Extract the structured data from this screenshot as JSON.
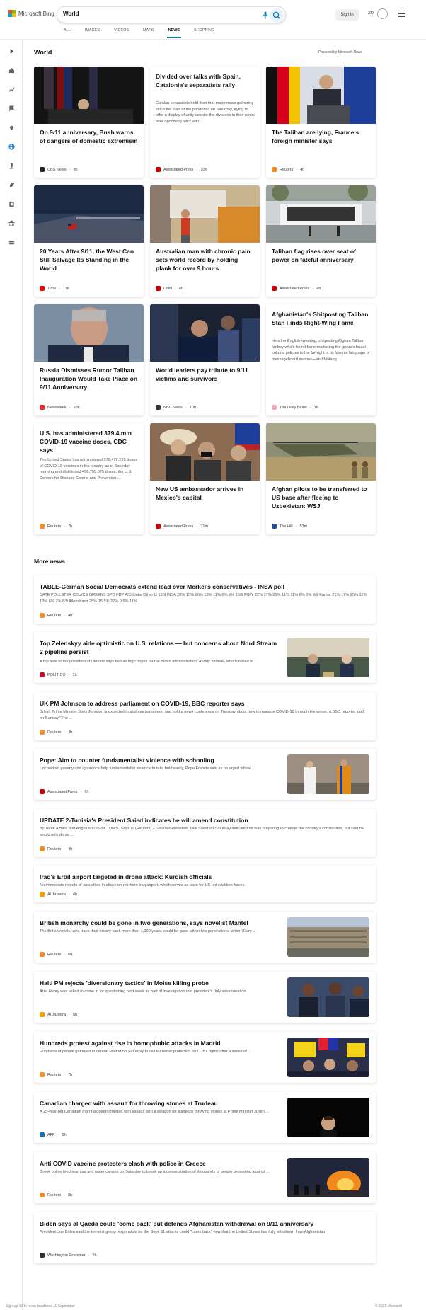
{
  "header": {
    "brand": "Microsoft Bing",
    "search_value": "World",
    "sign_in": "Sign in",
    "points": "20"
  },
  "tabs": [
    {
      "label": "ALL"
    },
    {
      "label": "IMAGES"
    },
    {
      "label": "VIDEOS"
    },
    {
      "label": "MAPS"
    },
    {
      "label": "NEWS",
      "active": true
    },
    {
      "label": "SHOPPING"
    }
  ],
  "section": {
    "title": "World",
    "powered": "Powered by Microsoft News"
  },
  "cards": [
    {
      "title": "On 9/11 anniversary, Bush warns of dangers of domestic extremism",
      "source": "CBS News",
      "time": "8h",
      "badge": "#222",
      "badge_icon": "eye-icon"
    },
    {
      "title": "Divided over talks with Spain, Catalonia's separatists rally",
      "desc": "Catalan separatists held their first major mass gathering since the start of the pandemic on Saturday, trying to offer a display of unity despite the divisions in their ranks over upcoming talks with ...",
      "source": "Associated Press",
      "time": "10h",
      "badge": "#c00",
      "badge_icon": "ap-icon"
    },
    {
      "title": "The Taliban are lying, France's foreign minister says",
      "source": "Reuters",
      "time": "4h",
      "badge": "#f28c28",
      "badge_icon": "reuters-icon"
    },
    {
      "title": "20 Years After 9/11, the West Can Still Salvage Its Standing in the World",
      "source": "Time",
      "time": "11h",
      "badge": "#e00",
      "badge_icon": "time-icon"
    },
    {
      "title": "Australian man with chronic pain sets world record by holding plank for over 9 hours",
      "source": "CNN",
      "time": "4h",
      "badge": "#cc0000",
      "badge_icon": "cnn-icon"
    },
    {
      "title": "Taliban flag rises over seat of power on fateful anniversary",
      "source": "Associated Press",
      "time": "4h",
      "badge": "#c00",
      "badge_icon": "ap-icon"
    },
    {
      "title": "Russia Dismisses Rumor Taliban Inauguration Would Take Place on 9/11 Anniversary",
      "source": "Newsweek",
      "time": "10h",
      "badge": "#e22",
      "badge_icon": "newsweek-icon"
    },
    {
      "title": "World leaders pay tribute to 9/11 victims and survivors",
      "source": "NBC News",
      "time": "10h",
      "badge": "#333",
      "badge_icon": "nbc-icon"
    },
    {
      "title": "Afghanistan's Shitposting Taliban Stan Finds Right-Wing Fame",
      "desc": "He's the English-tweeting, shitposting Afghan Taliban fanboy who's found fame marketing the group's brutal cultural policies to the far-right in its favorite language of messageboard memes—and Malang ...",
      "source": "The Daily Beast",
      "time": "1h",
      "badge": "#f4a6b0",
      "badge_icon": "daily-beast-icon"
    },
    {
      "title": "U.S. has administered 379.4 mln COVID-19 vaccine doses, CDC says",
      "desc": "The United States has administered 379,472,220 doses of COVID-19 vaccines in the country as of Saturday morning and distributed 456,755,075 doses, the U.S. Centers for Disease Control and Prevention ...",
      "source": "Reuters",
      "time": "7h",
      "badge": "#f28c28",
      "badge_icon": "reuters-icon"
    },
    {
      "title": "New US ambassador arrives in Mexico's capital",
      "source": "Associated Press",
      "time": "31m",
      "badge": "#c00",
      "badge_icon": "ap-icon"
    },
    {
      "title": "Afghan pilots to be transferred to US base after fleeing to Uzbekistan: WSJ",
      "source": "The Hill",
      "time": "53m",
      "badge": "#2a4a9a",
      "badge_icon": "the-hill-icon"
    }
  ],
  "more_news": {
    "title": "More news",
    "items": [
      {
        "title": "TABLE-German Social Democrats extend lead over Merkel's conservatives - INSA poll",
        "desc": "DATE POLLSTER CDU/CS GREENS SPD FDP AfD Linke Other U 12/9 INSA 20% 15% 26% 13% 11% 6% 9% 10/9 FGW 22% 17% 25% 11% 11% 6% 5% 9/9 Kantar 21% 17% 25% 12% 12% 6% 7% 8/9 Allensbach 25% 15.5% 27% 9.5% 11% ...",
        "source": "Reuters",
        "time": "4h",
        "badge": "#f28c28"
      },
      {
        "title": "Top Zelenskyy aide optimistic on U.S. relations — but concerns about Nord Stream 2 pipeline persist",
        "desc": "A top aide to the president of Ukraine says he has high hopes for the Biden administration. Andriy Yermak, who traveled to ...",
        "source": "POLITICO",
        "time": "1h",
        "badge": "#c8102e"
      },
      {
        "title": "UK PM Johnson to address parliament on COVID-19, BBC reporter says",
        "desc": "British Prime Minister Boris Johnson is expected to address parliament and hold a news conference on Tuesday about how to manage COVID-19 through the winter, a BBC reporter said on Sunday \"The ...",
        "source": "Reuters",
        "time": "4h",
        "badge": "#f28c28"
      },
      {
        "title": "Pope: Aim to counter fundamentalist violence with schooling",
        "desc": "Unchecked poverty and ignorance help fundamentalist violence to take hold easily, Pope Francis said as he urged fellow ...",
        "source": "Associated Press",
        "time": "6h",
        "badge": "#c00"
      },
      {
        "title": "UPDATE 2-Tunisia's President Saied indicates he will amend constitution",
        "desc": "By Tarek Amara and Angus McDowall TUNIS, Sept 11 (Reuters) - Tunisia's President Kais Saied on Saturday indicated he was preparing to change the country's constitution, but said he would only do so ...",
        "source": "Reuters",
        "time": "4h",
        "badge": "#f28c28"
      },
      {
        "title": "Iraq's Erbil airport targeted in drone attack: Kurdish officials",
        "desc": "No immediate reports of casualties in attack on northern Iraq airport, which serves as base for US-led coalition forces.",
        "source": "Al Jazeera",
        "time": "4h",
        "badge": "#f59c00"
      },
      {
        "title": "British monarchy could be gone in two generations, says novelist Mantel",
        "desc": "The British royals, who trace their history back more than 1,000 years, could be gone within two generations, writer Hilary ...",
        "source": "Reuters",
        "time": "6h",
        "badge": "#f28c28"
      },
      {
        "title": "Haiti PM rejects 'diversionary tactics' in Moise killing probe",
        "desc": "Ariel Henry was asked to come in for questioning next week as part of investigation into president's July assassination.",
        "source": "Al Jazeera",
        "time": "5h",
        "badge": "#f59c00"
      },
      {
        "title": "Hundreds protest against rise in homophobic attacks in Madrid",
        "desc": "Hundreds of people gathered in central Madrid on Saturday to call for better protection for LGBT rights after a series of ...",
        "source": "Reuters",
        "time": "7h",
        "badge": "#f28c28"
      },
      {
        "title": "Canadian charged with assault for throwing stones at Trudeau",
        "desc": "A 25-year-old Canadian man has been charged with assault with a weapon for allegedly throwing stones at Prime Minister Justin ...",
        "source": "AFP",
        "time": "5h",
        "badge": "#1a6fb5"
      },
      {
        "title": "Anti COVID vaccine protesters clash with police in Greece",
        "desc": "Greek police fired tear gas and water cannon on Saturday to break up a demonstration of thousands of people protesting against ...",
        "source": "Reuters",
        "time": "8h",
        "badge": "#f28c28"
      },
      {
        "title": "Biden says al Qaeda could 'come back' but defends Afghanistan withdrawal on 9/11 anniversary",
        "desc": "President Joe Biden said the terrorist group responsible for the Sept. 11 attacks could \"come back\" now that the United States has fully withdrawn from Afghanistan.",
        "source": "Washington Examiner",
        "time": "5h",
        "badge": "#333"
      }
    ]
  },
  "footer": {
    "left": "Sign-up 10 th  news headlines 11 September",
    "right": "© 2021 Microsoft"
  }
}
